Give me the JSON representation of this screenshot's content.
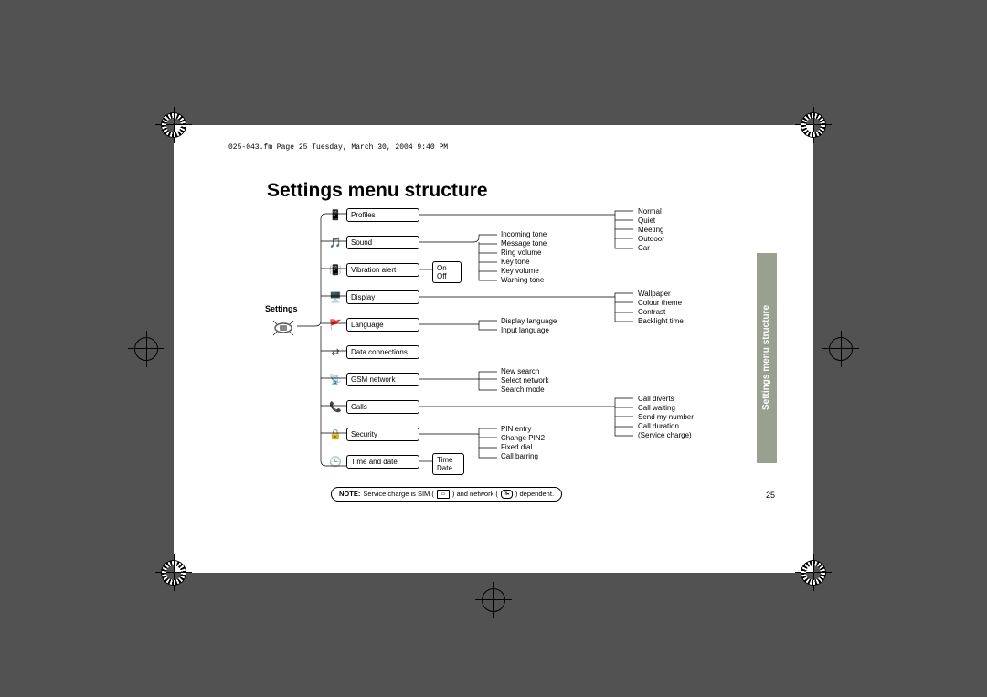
{
  "header": "025-043.fm Page 25 Tuesday, March 30, 2004 9:40 PM",
  "title": "Settings menu structure",
  "side_tab": "Settings menu structure",
  "page_number": "25",
  "root_label": "Settings",
  "menu": {
    "items": [
      {
        "label": "Profiles"
      },
      {
        "label": "Sound"
      },
      {
        "label": "Vibration alert"
      },
      {
        "label": "Display"
      },
      {
        "label": "Language"
      },
      {
        "label": "Data connections"
      },
      {
        "label": "GSM network"
      },
      {
        "label": "Calls"
      },
      {
        "label": "Security"
      },
      {
        "label": "Time and date"
      }
    ]
  },
  "vibration": {
    "on": "On",
    "off": "Off"
  },
  "timedate": {
    "time": "Time",
    "date": "Date"
  },
  "sound_items": {
    "l0": "Incoming tone",
    "l1": "Message tone",
    "l2": "Ring volume",
    "l3": "Key tone",
    "l4": "Key volume",
    "l5": "Warning tone"
  },
  "language_items": {
    "l0": "Display language",
    "l1": "Input language"
  },
  "gsm_items": {
    "l0": "New search",
    "l1": "Select network",
    "l2": "Search mode"
  },
  "security_items": {
    "l0": "PIN entry",
    "l1": "Change PIN2",
    "l2": "Fixed dial",
    "l3": "Call barring"
  },
  "profiles_items": {
    "l0": "Normal",
    "l1": "Quiet",
    "l2": "Meeting",
    "l3": "Outdoor",
    "l4": "Car"
  },
  "display_items": {
    "l0": "Wallpaper",
    "l1": "Colour theme",
    "l2": "Contrast",
    "l3": "Backlight time"
  },
  "calls_items": {
    "l0": "Call diverts",
    "l1": "Call waiting",
    "l2": "Send my number",
    "l3": "Call duration",
    "l4": "(Service charge)"
  },
  "note": {
    "prefix": "NOTE:",
    "t1": " Service charge is SIM (",
    "t2": ") and network (",
    "t3": ") dependent."
  }
}
